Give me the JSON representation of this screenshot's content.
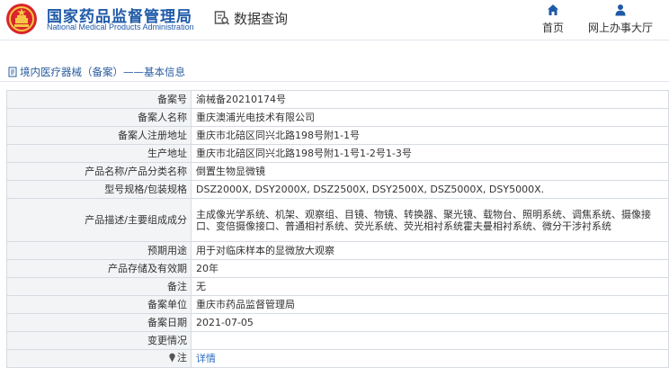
{
  "header": {
    "brand_cn": "国家药品监督管理局",
    "brand_en": "National Medical Products Administration",
    "query_label": "数据查询",
    "nav": [
      {
        "label": "首页",
        "icon": "home-icon"
      },
      {
        "label": "网上办事大厅",
        "icon": "user-icon"
      }
    ],
    "brand_color": "#1f5aa8"
  },
  "breadcrumb": "境内医疗器械（备案）——基本信息",
  "rows": [
    {
      "label": "备案号",
      "value": "渝械备20210174号"
    },
    {
      "label": "备案人名称",
      "value": "重庆澳浦光电技术有限公司"
    },
    {
      "label": "备案人注册地址",
      "value": "重庆市北碚区同兴北路198号附1-1号"
    },
    {
      "label": "生产地址",
      "value": "重庆市北碚区同兴北路198号附1-1号1-2号1-3号"
    },
    {
      "label": "产品名称/产品分类名称",
      "value": "倒置生物显微镜"
    },
    {
      "label": "型号规格/包装规格",
      "value": "DSZ2000X, DSY2000X, DSZ2500X, DSY2500X, DSZ5000X, DSY5000X."
    },
    {
      "label": "产品描述/主要组成成分",
      "value": "主成像光学系统、机架、观察组、目镜、物镜、转换器、聚光镜、载物台、照明系统、调焦系统、摄像接口、变倍摄像接口、普通相衬系统、荧光系统、荧光相衬系统霍夫曼相衬系统、微分干涉衬系统"
    },
    {
      "label": "预期用途",
      "value": "用于对临床样本的显微放大观察"
    },
    {
      "label": "产品存储及有效期",
      "value": "20年"
    },
    {
      "label": "备注",
      "value": "无"
    },
    {
      "label": "备案单位",
      "value": "重庆市药品监督管理局"
    },
    {
      "label": "备案日期",
      "value": "2021-07-05"
    },
    {
      "label": "变更情况",
      "value": ""
    }
  ],
  "note_row": {
    "label": "注",
    "value": "详情",
    "icon": "pin-icon"
  }
}
